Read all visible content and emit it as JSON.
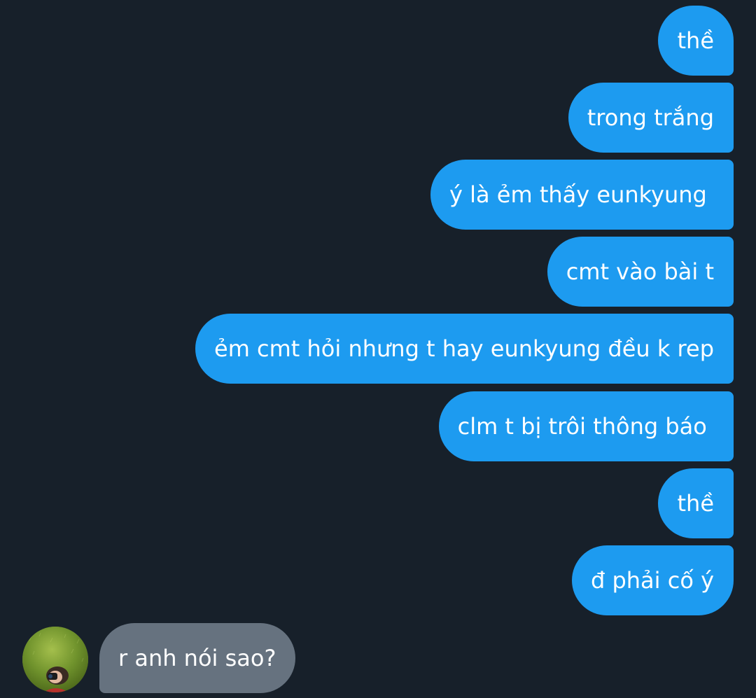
{
  "colors": {
    "background": "#17202a",
    "outgoing_bubble": "#1d9bf0",
    "incoming_bubble": "#66727f",
    "text": "#ffffff"
  },
  "messages": {
    "outgoing": [
      {
        "text": "thề"
      },
      {
        "text": "trong trắng"
      },
      {
        "text": "ý là ẻm thấy eunkyung "
      },
      {
        "text": "cmt vào bài t"
      },
      {
        "text": "ẻm cmt hỏi nhưng t hay eunkyung đều k rep"
      },
      {
        "text": "clm t bị trôi thông báo "
      },
      {
        "text": "thề"
      },
      {
        "text": "đ phải cố ý"
      }
    ],
    "incoming": [
      {
        "text": "r anh nói sao?",
        "avatar_icon": "user-avatar-icon"
      }
    ]
  }
}
